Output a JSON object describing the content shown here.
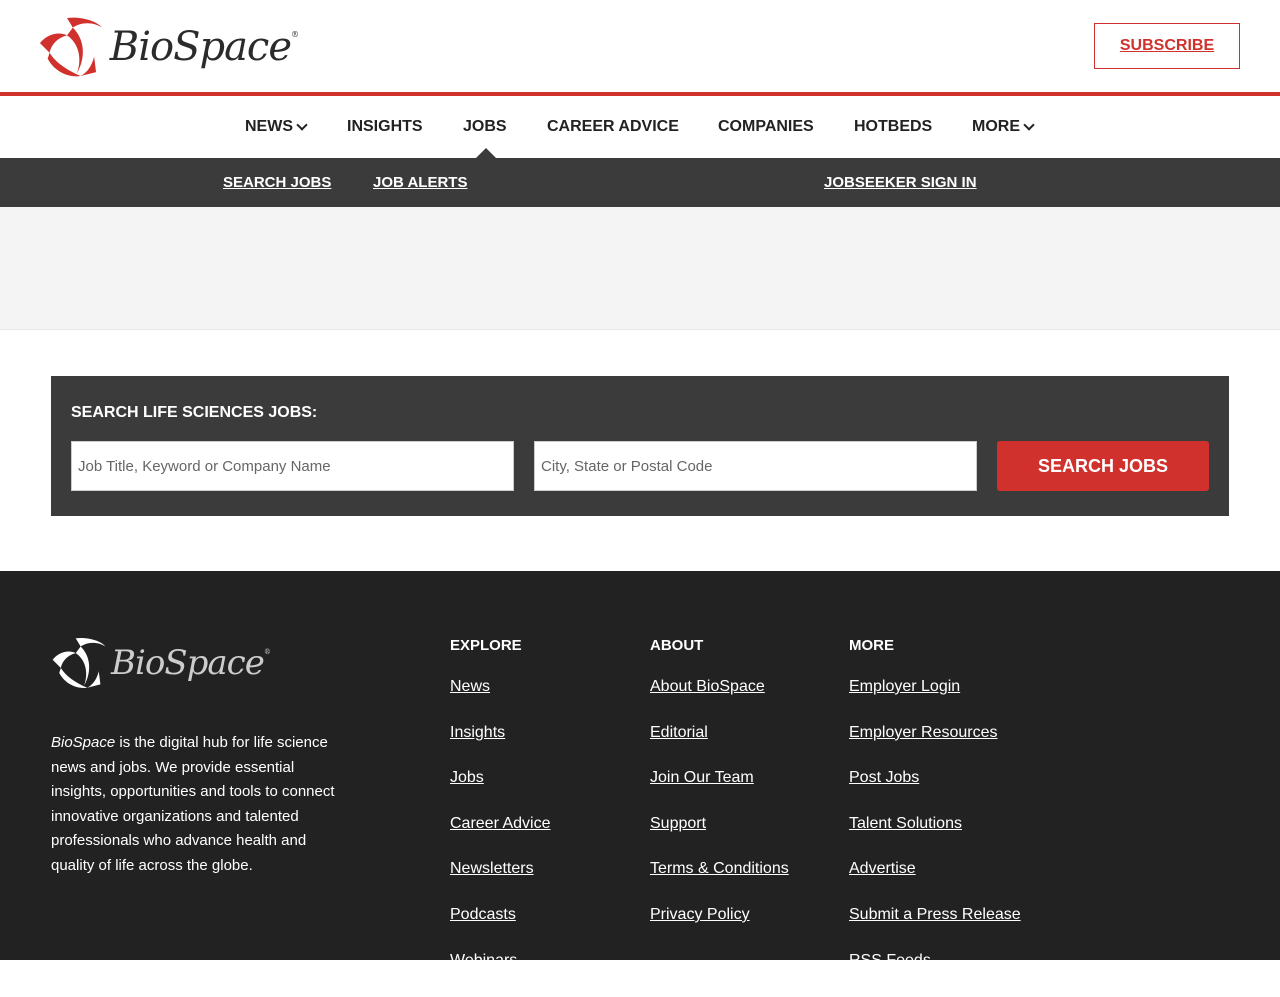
{
  "header": {
    "logo_text": "BioSpace",
    "subscribe_label": "SUBSCRIBE"
  },
  "nav": {
    "items": [
      {
        "label": "NEWS",
        "has_dropdown": true
      },
      {
        "label": "INSIGHTS",
        "has_dropdown": false
      },
      {
        "label": "JOBS",
        "has_dropdown": false,
        "active": true
      },
      {
        "label": "CAREER ADVICE",
        "has_dropdown": false
      },
      {
        "label": "COMPANIES",
        "has_dropdown": false
      },
      {
        "label": "HOTBEDS",
        "has_dropdown": false
      },
      {
        "label": "MORE",
        "has_dropdown": true
      }
    ]
  },
  "subnav": {
    "search_jobs": "SEARCH JOBS",
    "job_alerts": "JOB ALERTS",
    "signin": "JOBSEEKER SIGN IN"
  },
  "search": {
    "heading": "SEARCH LIFE SCIENCES JOBS:",
    "keyword_placeholder": "Job Title, Keyword or Company Name",
    "location_placeholder": "City, State or Postal Code",
    "button_label": "SEARCH JOBS"
  },
  "footer": {
    "logo_text": "BioSpace",
    "description_brand": "BioSpace",
    "description_rest": " is the digital hub for life science news and jobs. We provide essential insights, opportunities and tools to connect innovative organizations and talented professionals who advance health and quality of life across the globe.",
    "columns": [
      {
        "title": "EXPLORE",
        "links": [
          "News",
          "Insights",
          "Jobs",
          "Career Advice",
          "Newsletters",
          "Podcasts",
          "Webinars"
        ]
      },
      {
        "title": "ABOUT",
        "links": [
          "About BioSpace",
          "Editorial",
          "Join Our Team",
          "Support",
          "Terms & Conditions",
          "Privacy Policy"
        ]
      },
      {
        "title": "MORE",
        "links": [
          "Employer Login",
          "Employer Resources",
          "Post Jobs",
          "Talent Solutions",
          "Advertise",
          "Submit a Press Release",
          "RSS Feeds"
        ]
      }
    ]
  },
  "colors": {
    "brand_red": "#d0312d",
    "dark_bar": "#3b3b3b",
    "footer_bg": "#222222"
  }
}
